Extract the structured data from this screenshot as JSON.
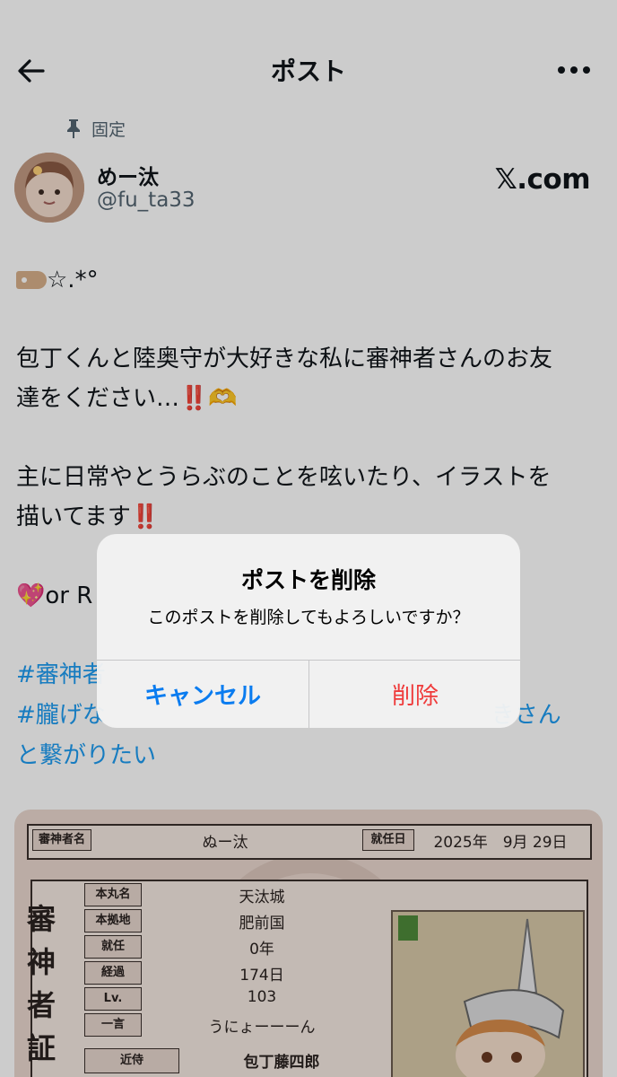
{
  "header": {
    "title": "ポスト"
  },
  "pinned": {
    "label": "固定"
  },
  "author": {
    "display_name": "めー汰",
    "handle": "@fu_ta33",
    "source_badge": "𝕏.com"
  },
  "post": {
    "line1_suffix": "☆.*°",
    "para1a": "包丁くんと陸奥守が大好きな私に審神者さんのお友",
    "para1b": "達をください…",
    "para1_excl": "‼️",
    "para1_hand": "🫶",
    "para2a": "主に日常やとうらぶのことを呟いたり、イラストを",
    "para2b": "描いてます",
    "para2_excl": "‼️",
    "para3_heart": "💖",
    "para3_text": "or R",
    "hashtag_line1": "#審神者",
    "hashtag_line2a": "#朧げな",
    "hashtag_line2b": "きさん",
    "hashtag_line3": "と繋がりたい"
  },
  "card": {
    "row1": {
      "label1": "審神者名",
      "value1": "ぬー汰",
      "label2": "就任日",
      "value2": "2025年　9月 29日"
    },
    "vertical_title": [
      "審",
      "神",
      "者",
      "証"
    ],
    "rows": [
      {
        "label": "本丸名",
        "value": "天汰城"
      },
      {
        "label": "本拠地",
        "value": "肥前国"
      },
      {
        "label": "就任",
        "value": "0年"
      },
      {
        "label": "経過",
        "value": "174日"
      },
      {
        "label": "Lv.",
        "value": "103"
      },
      {
        "label": "一言",
        "value": "うにょーーーん"
      }
    ],
    "attendant": {
      "label": "近侍",
      "value": "包丁藤四郎"
    }
  },
  "dialog": {
    "title": "ポストを削除",
    "message": "このポストを削除してもよろしいですか？",
    "cancel_label": "キャンセル",
    "delete_label": "削除"
  },
  "colors": {
    "link": "#1d9bf0",
    "cancel": "#0a7cf0",
    "destructive": "#ef3b3b"
  }
}
